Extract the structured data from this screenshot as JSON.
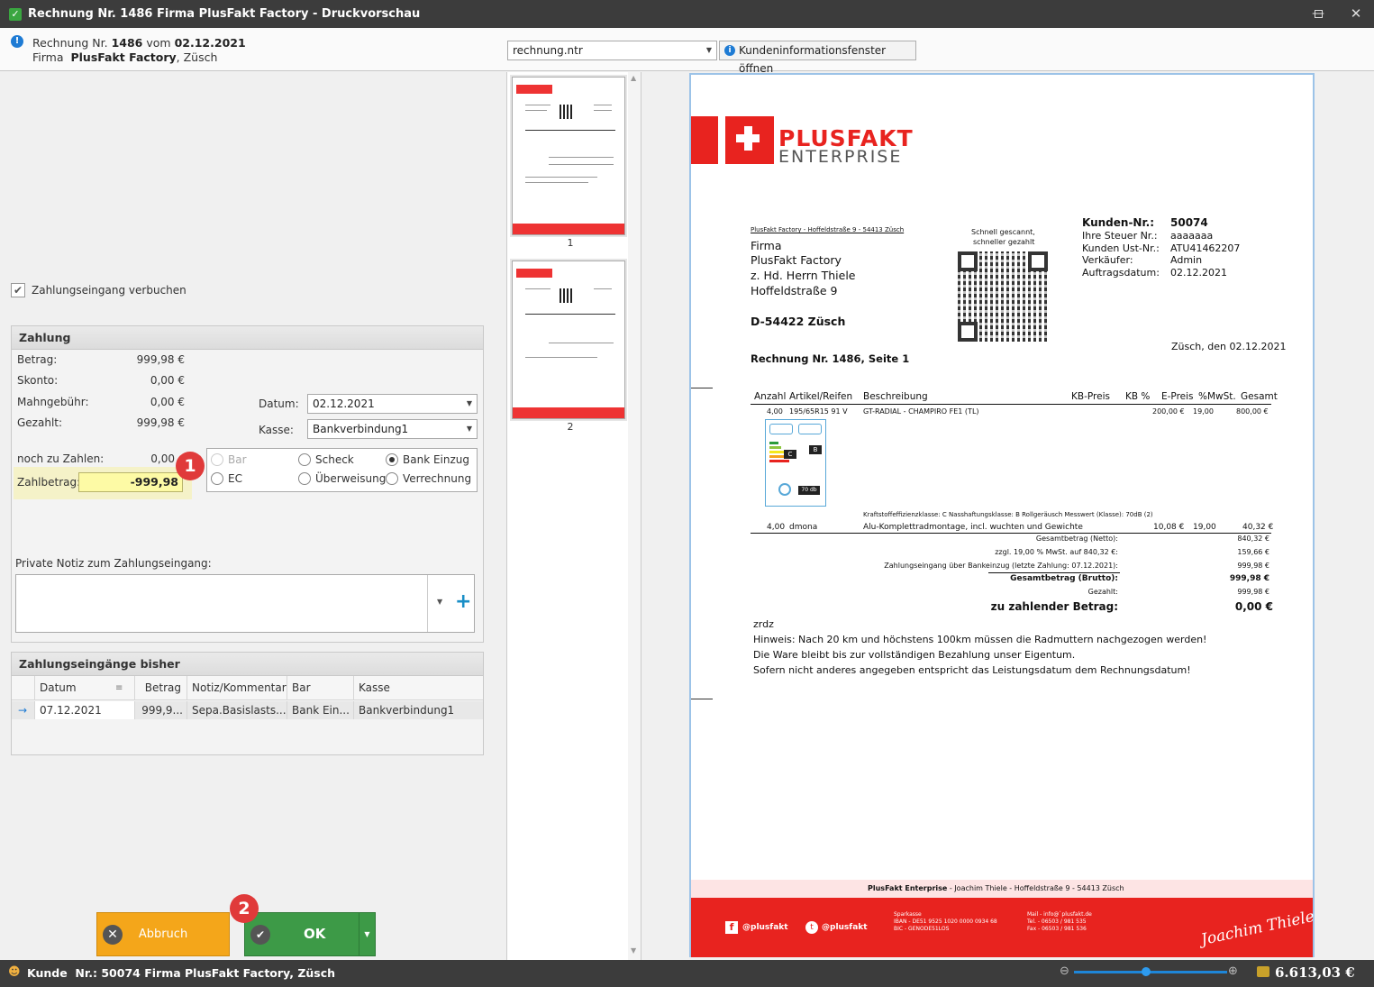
{
  "window": {
    "title": "Rechnung Nr. 1486 Firma PlusFakt Factory - Druckvorschau"
  },
  "info": {
    "prefix": "Rechnung Nr.",
    "number": "1486",
    "vom": "vom",
    "date": "02.12.2021",
    "firma_label": "Firma",
    "firma": "PlusFakt Factory",
    "ort": ", Züsch"
  },
  "template_combo": "rechnung.ntr",
  "customer_window_button": "Kundeninformationsfenster öffnen",
  "payment_checkbox": "Zahlungseingang verbuchen",
  "zahlung": {
    "title": "Zahlung",
    "betrag_label": "Betrag:",
    "betrag": "999,98 €",
    "skonto_label": "Skonto:",
    "skonto": "0,00 €",
    "mahn_label": "Mahngebühr:",
    "mahn": "0,00 €",
    "gezahlt_label": "Gezahlt:",
    "gezahlt": "999,98 €",
    "datum_label": "Datum:",
    "datum": "02.12.2021",
    "kasse_label": "Kasse:",
    "kasse": "Bankverbindung1",
    "noch_label": "noch zu Zahlen:",
    "noch": "0,00",
    "zahlbetrag_label": "Zahlbetrag:",
    "zahlbetrag": "-999,98",
    "radios": {
      "bar": "Bar",
      "scheck": "Scheck",
      "bank": "Bank Einzug",
      "ec": "EC",
      "ueberweisung": "Überweisung",
      "verrechnung": "Verrechnung"
    },
    "notiz_label": "Private Notiz zum Zahlungseingang:"
  },
  "history": {
    "title": "Zahlungseingänge bisher",
    "columns": [
      "Datum",
      "Betrag",
      "Notiz/Kommentar",
      "Bar",
      "Kasse"
    ],
    "rows": [
      {
        "datum": "07.12.2021",
        "betrag": "999,9...",
        "notiz": "Sepa.Basislasts...",
        "bar": "Bank Ein...",
        "kasse": "Bankverbindung1"
      }
    ]
  },
  "buttons": {
    "cancel": "Abbruch",
    "ok": "OK"
  },
  "badges": [
    "1",
    "2"
  ],
  "thumbnails": [
    "1",
    "2"
  ],
  "invoice": {
    "logo_top": "PLUSFAKT",
    "logo_bottom": "ENTERPRISE",
    "sender_line": "PlusFakt Factory - Hoffeldstraße 9 - 54413 Züsch",
    "address": [
      "Firma",
      "PlusFakt Factory",
      "z. Hd. Herrn Thiele",
      "Hoffeldstraße 9"
    ],
    "city": "D-54422 Züsch",
    "qr_caption1": "Schnell gescannt,",
    "qr_caption2": "schneller gezahlt",
    "meta": [
      [
        "Kunden-Nr.:",
        "50074"
      ],
      [
        "Ihre Steuer Nr.:",
        "aaaaaaa"
      ],
      [
        "Kunden Ust-Nr.:",
        "ATU41462207"
      ],
      [
        "Verkäufer:",
        "Admin"
      ],
      [
        "Auftragsdatum:",
        "02.12.2021"
      ]
    ],
    "place_date": "Züsch, den 02.12.2021",
    "heading": "Rechnung Nr. 1486, Seite 1",
    "cols": [
      "Anzahl",
      "Artikel/Reifen",
      "Beschreibung",
      "KB-Preis",
      "KB %",
      "E-Preis",
      "%MwSt.",
      "Gesamt"
    ],
    "item1": {
      "anzahl": "4,00",
      "artikel": "195/65R15 91 V",
      "beschreibung": "GT-RADIAL - CHAMPIRO FE1 (TL)",
      "epreis": "200,00 €",
      "mwst": "19,00",
      "gesamt": "800,00 €"
    },
    "label_line": "Kraftstoffeffizienzklasse: C    Nasshaftungsklasse: B    Rollgeräusch Messwert (Klasse): 70dB (2)",
    "item2": {
      "anzahl": "4,00",
      "artikel": "dmona",
      "beschreibung": "Alu-Komplettradmontage, incl. wuchten und Gewichte",
      "epreis": "10,08 €",
      "mwst": "19,00",
      "gesamt": "40,32 €"
    },
    "totals": [
      [
        "Gesamtbetrag (Netto):",
        "840,32 €"
      ],
      [
        "zzgl. 19,00 % MwSt. auf 840,32 €:",
        "159,66 €"
      ],
      [
        "Zahlungseingang über Bankeinzug (letzte Zahlung: 07.12.2021):",
        "999,98 €"
      ],
      [
        "Gesamtbetrag (Brutto):",
        "999,98 €"
      ],
      [
        "Gezahlt:",
        "999,98 €"
      ]
    ],
    "due_label": "zu zahlender Betrag:",
    "due": "0,00 €",
    "notes": [
      "zrdz",
      "Hinweis: Nach 20 km und höchstens 100km müssen die Radmuttern nachgezogen werden!",
      "Die Ware bleibt bis zur vollständigen Bezahlung unser Eigentum.",
      "Sofern nicht anderes angegeben entspricht das Leistungsdatum dem Rechnungsdatum!"
    ],
    "footer_company": "PlusFakt Enterprise",
    "footer_rest": " - Joachim Thiele - Hoffeldstraße 9 - 54413 Züsch",
    "social_fb": "@plusfakt",
    "social_tw": "@plusfakt",
    "bank": [
      "Sparkasse",
      "IBAN - DE51 9525 1020 0000 0934 68",
      "BIC - GENODE51LOS"
    ],
    "contact": [
      "Mail - info@`plusfakt.de",
      "Tel. - 06503 / 981 535",
      "Fax - 06503 / 981 536"
    ],
    "signature": "Joachim Thiele",
    "energy_c": "C",
    "energy_b": "B",
    "noise": "70 db"
  },
  "status": {
    "prefix": "Kunde",
    "text": "Nr.: 50074 Firma  PlusFakt Factory, Züsch",
    "balance": "6.613,03 €"
  },
  "colors": {
    "accent_red": "#e8231f",
    "ok_green": "#3d9a47",
    "cancel_orange": "#f4a61a"
  }
}
